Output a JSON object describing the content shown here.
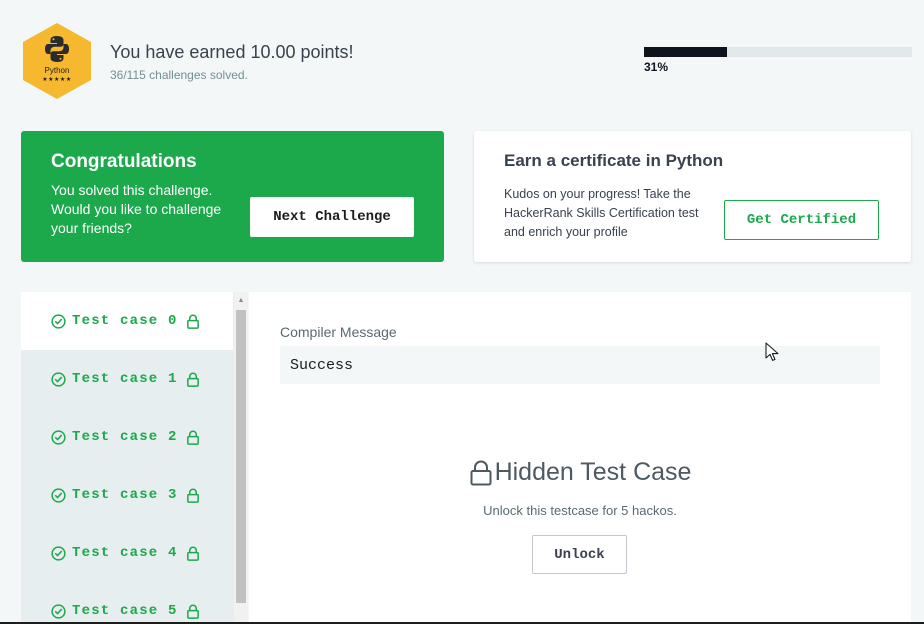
{
  "header": {
    "badge_label": "Python",
    "badge_stars": "★★★★★",
    "points_title": "You have earned 10.00 points!",
    "solved_count": "36/115 challenges solved.",
    "progress_percent": 31,
    "progress_label": "31%"
  },
  "congrats": {
    "title": "Congratulations",
    "text": "You solved this challenge. Would you like to challenge your friends?",
    "next_button": "Next Challenge"
  },
  "certificate": {
    "title": "Earn a certificate in Python",
    "text": "Kudos on your progress! Take the HackerRank Skills Certification test and enrich your profile",
    "button": "Get Certified"
  },
  "test_cases": [
    {
      "label": "Test case 0",
      "active": true
    },
    {
      "label": "Test case 1",
      "active": false
    },
    {
      "label": "Test case 2",
      "active": false
    },
    {
      "label": "Test case 3",
      "active": false
    },
    {
      "label": "Test case 4",
      "active": false
    },
    {
      "label": "Test case 5",
      "active": false
    }
  ],
  "output": {
    "compiler_label": "Compiler Message",
    "compiler_value": "Success",
    "hidden_title": "Hidden Test Case",
    "unlock_note": "Unlock this testcase for 5 hackos.",
    "unlock_button": "Unlock"
  },
  "colors": {
    "accent_green": "#1ba94c",
    "badge_gold": "#f5b82e",
    "progress_dark": "#0e141e",
    "background": "#f3f7f7"
  },
  "icons": {
    "badge": "python-badge-icon",
    "test_status": "check-circle-icon",
    "test_lock": "lock-icon",
    "hidden_lock": "lock-icon",
    "pointer": "mouse-cursor-icon"
  }
}
